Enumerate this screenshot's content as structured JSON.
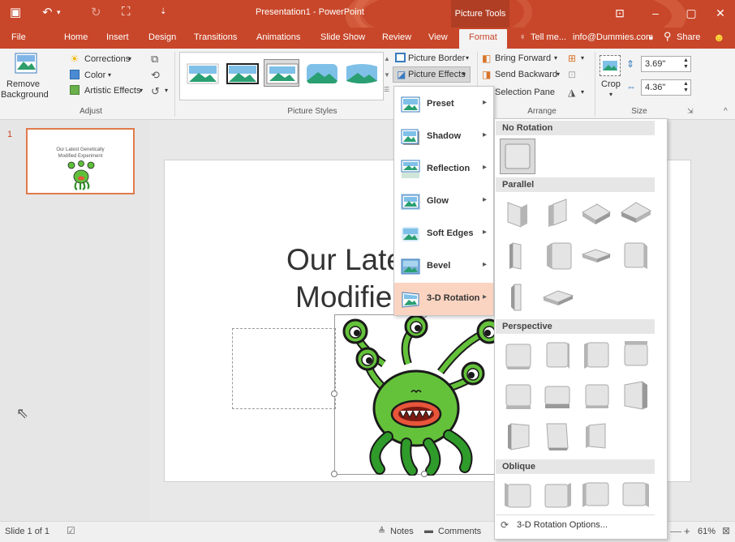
{
  "window": {
    "title": "Presentation1 - PowerPoint",
    "context_tab": "Picture Tools",
    "minimize": "–",
    "maximize": "▢",
    "close": "✕"
  },
  "tabs": [
    "File",
    "Home",
    "Insert",
    "Design",
    "Transitions",
    "Animations",
    "Slide Show",
    "Review",
    "View",
    "Format"
  ],
  "tell_me": "Tell me...",
  "account": "info@Dummies.com",
  "share": "Share",
  "ribbon": {
    "remove_bg_1": "Remove",
    "remove_bg_2": "Background",
    "corrections": "Corrections",
    "color": "Color",
    "artistic": "Artistic Effects",
    "adjust_label": "Adjust",
    "styles_label": "Picture Styles",
    "picture_border": "Picture Border",
    "picture_effects": "Picture Effects",
    "bring_forward": "Bring Forward",
    "send_backward": "Send Backward",
    "selection_pane": "Selection Pane",
    "arrange_label": "Arrange",
    "crop": "Crop",
    "height": "3.69\"",
    "width": "4.36\"",
    "size_label": "Size"
  },
  "thumb": {
    "number": "1",
    "line1": "Our Latest Genetically",
    "line2": "Modified Experiment"
  },
  "slide": {
    "title_line1": "Our Late",
    "title_line2": "Modifie"
  },
  "effects_menu": [
    "Preset",
    "Shadow",
    "Reflection",
    "Glow",
    "Soft Edges",
    "Bevel",
    "3-D Rotation"
  ],
  "rotation_menu": {
    "no_rotation": "No Rotation",
    "parallel": "Parallel",
    "perspective": "Perspective",
    "oblique": "Oblique",
    "options": "3-D Rotation Options..."
  },
  "status": {
    "slide": "Slide 1 of 1",
    "notes": "Notes",
    "comments": "Comments",
    "zoom": "61%"
  }
}
